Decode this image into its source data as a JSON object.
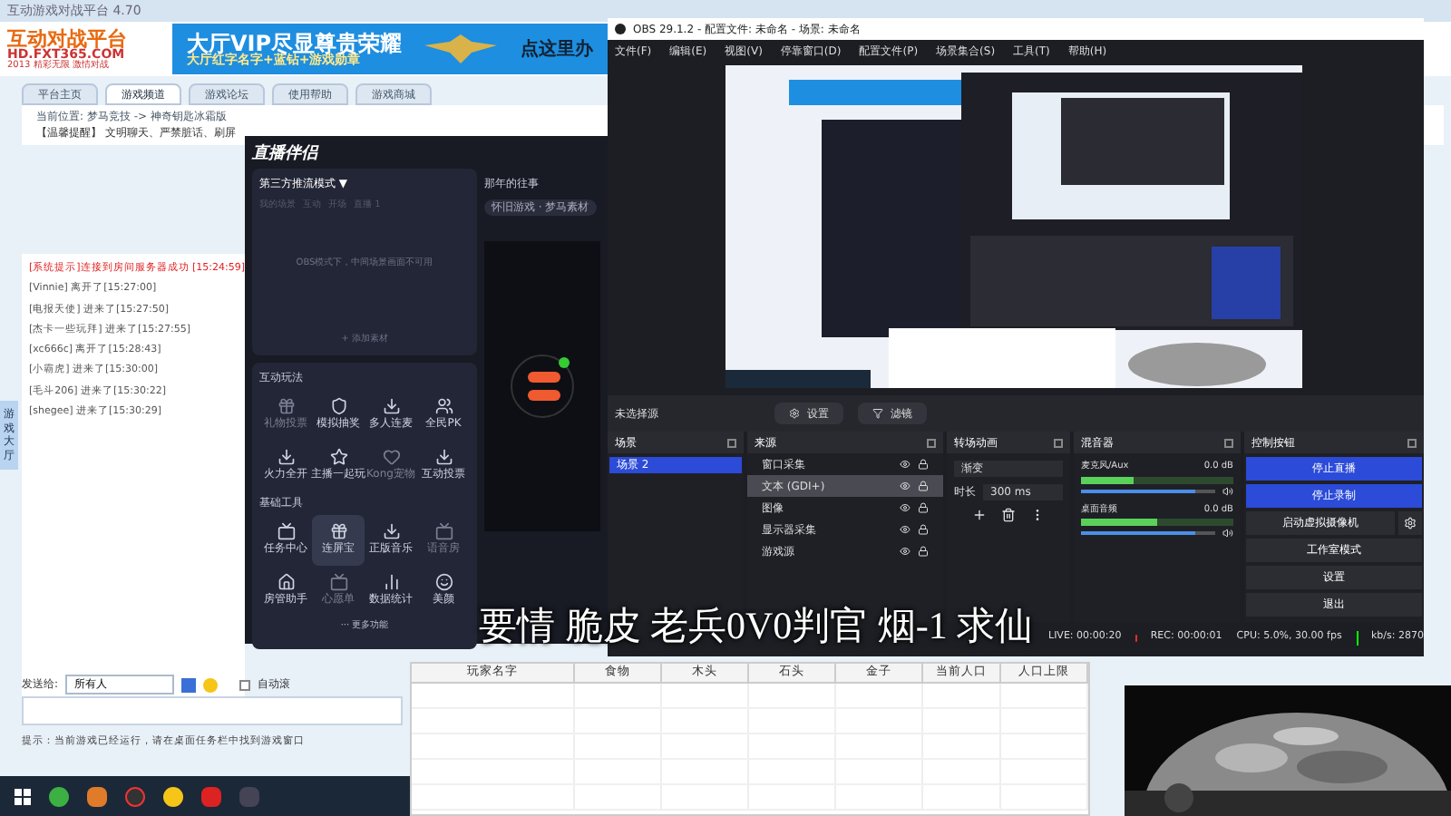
{
  "lobby": {
    "title": "互动游戏对战平台 4.70",
    "banner": {
      "logo_title": "互动对战平台",
      "logo_url": "HD.FXT365.COM",
      "logo_slogan": "2013 精彩无限 激情对战",
      "headline": "大厅VIP尽显尊贵荣耀",
      "subline": "大厅红字名字+蓝钻+游戏勋章",
      "cta": "点这里办"
    },
    "tabs": [
      {
        "label": "平台主页",
        "selected": false
      },
      {
        "label": "游戏频道",
        "selected": true
      },
      {
        "label": "游戏论坛",
        "selected": false
      },
      {
        "label": "使用帮助",
        "selected": false
      },
      {
        "label": "游戏商城",
        "selected": false
      }
    ],
    "breadcrumb": "当前位置: 梦马竞技 -> 神奇钥匙冰霜版",
    "notice": "【温馨提醒】 文明聊天、严禁脏话、刷屏",
    "chat": [
      {
        "kind": "system",
        "text": "[系统提示]连接到房间服务器成功 [15:24:59]"
      },
      {
        "kind": "user",
        "text": "[Vinnie] 离开了[15:27:00]"
      },
      {
        "kind": "user",
        "text": "[电报天使] 进来了[15:27:50]"
      },
      {
        "kind": "user",
        "text": "[杰卡一些玩拜] 进来了[15:27:55]"
      },
      {
        "kind": "user",
        "text": "[xc666c] 离开了[15:28:43]"
      },
      {
        "kind": "user",
        "text": "[小霸虎] 进来了[15:30:00]"
      },
      {
        "kind": "user",
        "text": "[毛斗206] 进来了[15:30:22]"
      },
      {
        "kind": "user",
        "text": "[shegee] 进来了[15:30:29]"
      }
    ],
    "send_label": "发送给:",
    "send_target": "所有人",
    "auto_scroll": {
      "label": "自动滚",
      "checked": false
    },
    "hint": "提示：当前游戏已经运行，请在桌面任务栏中找到游戏窗口",
    "side_tab": "游戏大厅"
  },
  "companion": {
    "title": "直播伴侣",
    "mode": "第三方推流模式 ▼",
    "scene_tabs": [
      {
        "label": "我的场景",
        "selected": false
      },
      {
        "label": "互动",
        "selected": false
      },
      {
        "label": "开场",
        "selected": false
      },
      {
        "label": "直播 1",
        "selected": false
      }
    ],
    "empty_note": "OBS模式下，中间场景画面不可用",
    "add_material": "+ 添加素材",
    "sections": [
      {
        "title": "互动玩法",
        "items": [
          {
            "label": "礼物投票",
            "disabled": true,
            "selected": false
          },
          {
            "label": "模拟抽奖",
            "disabled": false,
            "selected": false
          },
          {
            "label": "多人连麦",
            "disabled": false,
            "selected": false
          },
          {
            "label": "全民PK",
            "disabled": false,
            "selected": false
          },
          {
            "label": "火力全开",
            "disabled": false,
            "selected": false
          },
          {
            "label": "主播一起玩",
            "disabled": false,
            "selected": false
          },
          {
            "label": "Kong宠物",
            "disabled": true,
            "selected": false
          },
          {
            "label": "互动投票",
            "disabled": false,
            "selected": false
          }
        ]
      },
      {
        "title": "基础工具",
        "items": [
          {
            "label": "任务中心",
            "disabled": false,
            "selected": false
          },
          {
            "label": "连屏宝",
            "disabled": false,
            "selected": true
          },
          {
            "label": "正版音乐",
            "disabled": false,
            "selected": false
          },
          {
            "label": "语音房",
            "disabled": true,
            "selected": false
          },
          {
            "label": "房管助手",
            "disabled": false,
            "selected": false
          },
          {
            "label": "心愿单",
            "disabled": true,
            "selected": false
          },
          {
            "label": "数据统计",
            "disabled": false,
            "selected": false
          },
          {
            "label": "美颜",
            "disabled": false,
            "selected": false
          }
        ]
      }
    ],
    "more": "··· 更多功能",
    "stream_title": "那年的往事",
    "tag": "怀旧游戏 · 梦马素材"
  },
  "obs": {
    "title": "OBS 29.1.2 - 配置文件: 未命名 - 场景: 未命名",
    "menu": [
      "文件(F)",
      "编辑(E)",
      "视图(V)",
      "停靠窗口(D)",
      "配置文件(P)",
      "场景集合(S)",
      "工具(T)",
      "帮助(H)"
    ],
    "no_source": "未选择源",
    "source_buttons": [
      "设置",
      "滤镜"
    ],
    "docks": {
      "scenes": "场景",
      "sources": "来源",
      "transitions": "转场动画",
      "mixer": "混音器",
      "controls": "控制按钮"
    },
    "scenes": [
      {
        "label": "场景 2",
        "selected": true
      }
    ],
    "sources": [
      {
        "label": "窗口采集",
        "selected": false
      },
      {
        "label": "文本 (GDI+)",
        "selected": true
      },
      {
        "label": "图像",
        "selected": false
      },
      {
        "label": "显示器采集",
        "selected": false
      },
      {
        "label": "游戏源",
        "selected": false
      }
    ],
    "transition": "渐变",
    "duration_label": "时长",
    "duration": "300 ms",
    "channels": [
      {
        "name": "麦克风/Aux",
        "reading": "0.0 dB",
        "meter": {
          "level": 0.35
        },
        "volume": {
          "level": 0.85
        }
      },
      {
        "name": "桌面音频",
        "reading": "0.0 dB",
        "meter": {
          "level": 0.5
        },
        "volume": {
          "level": 0.85
        }
      }
    ],
    "controls": [
      {
        "label": "停止直播",
        "kind": "primary"
      },
      {
        "label": "停止录制",
        "kind": "primary"
      },
      {
        "label": "启动虚拟摄像机",
        "kind": "gear"
      },
      {
        "label": "工作室模式",
        "kind": "plain"
      },
      {
        "label": "设置",
        "kind": "plain"
      },
      {
        "label": "退出",
        "kind": "plain"
      }
    ],
    "status": {
      "live": "LIVE: 00:00:20",
      "rec": "REC: 00:00:01",
      "cpu": "CPU: 5.0%, 30.00 fps",
      "kbps": "kb/s: 2870"
    }
  },
  "subtitle": "要情 脆皮 老兵0V0判官 烟-1 求仙",
  "table": {
    "columns": [
      "玩家名字",
      "食物",
      "木头",
      "石头",
      "金子",
      "当前人口",
      "人口上限"
    ]
  }
}
